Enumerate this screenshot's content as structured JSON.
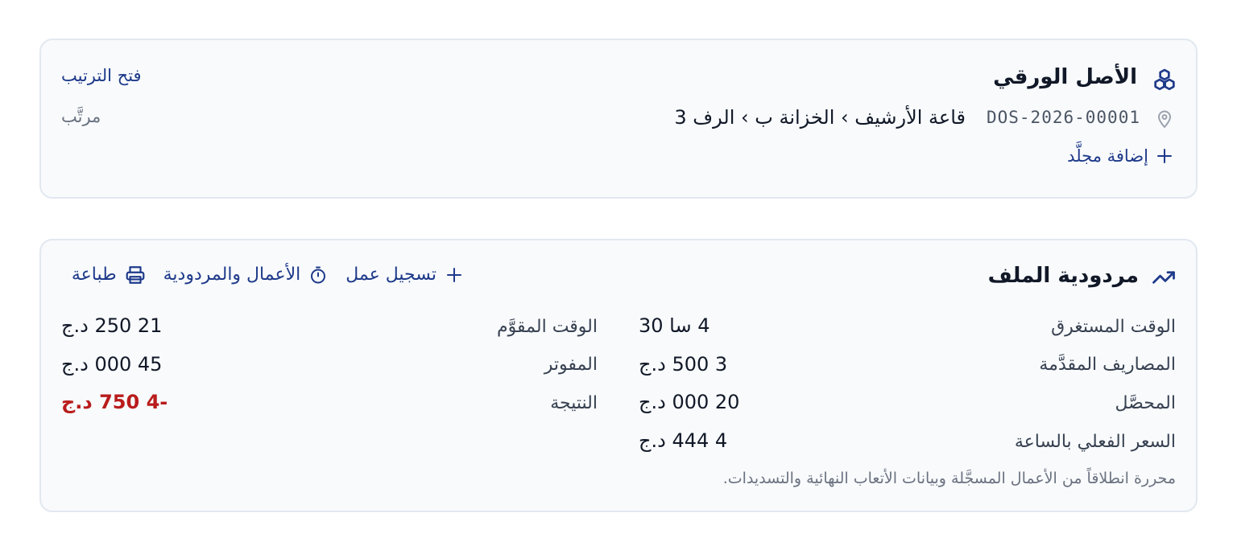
{
  "physical": {
    "title": "الأصل الورقي",
    "open_sort_label": "فتح الترتيب",
    "status": "مرتَّب",
    "reference": "DOS-2026-00001",
    "location_path": "قاعة الأرشيف › الخزانة ب › الرف 3",
    "add_binder_label": "إضافة مجلَّد"
  },
  "profit": {
    "title": "مردودية الملف",
    "actions": {
      "log_work": "تسجيل عمل",
      "work_and_profit": "الأعمال والمردودية",
      "print": "طباعة"
    },
    "metrics_right": [
      {
        "label": "الوقت المستغرق",
        "value": "4 سا 30"
      },
      {
        "label": "المصاريف المقدَّمة",
        "value": "3 500 د.ج"
      },
      {
        "label": "المحصَّل",
        "value": "20 000 د.ج"
      },
      {
        "label": "السعر الفعلي بالساعة",
        "value": "4 444 د.ج"
      }
    ],
    "metrics_left": [
      {
        "label": "الوقت المقوَّم",
        "value": "21 250 د.ج"
      },
      {
        "label": "المفوتر",
        "value": "45 000 د.ج"
      },
      {
        "label": "النتيجة",
        "value": "-4 750 د.ج",
        "negative": true
      }
    ],
    "footnote": "محررة انطلاقاً من الأعمال المسجَّلة وبيانات الأتعاب النهائية والتسديدات."
  },
  "colors": {
    "accent": "#1e3a8a",
    "negative": "#b91c1c",
    "card_bg": "#f8fafc",
    "card_border": "#e2e8f0"
  },
  "icons": [
    "boxes-icon",
    "location-pin-icon",
    "plus-icon",
    "trending-up-icon",
    "timer-icon",
    "printer-icon"
  ]
}
